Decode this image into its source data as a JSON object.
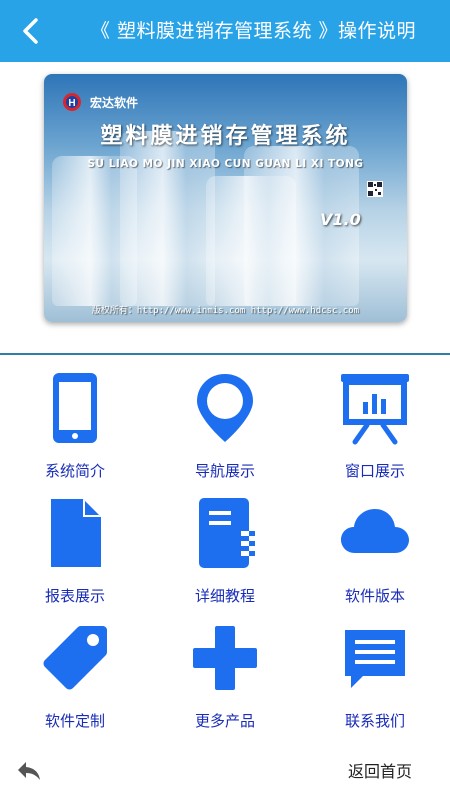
{
  "header": {
    "title": "《 塑料膜进销存管理系统 》操作说明",
    "back_icon": "chevron-left-icon",
    "background": "#29a3e8"
  },
  "banner": {
    "company": "宏达软件",
    "product_title": "塑料膜进销存管理系统",
    "pinyin": "SU LIAO MO JIN XIAO CUN GUAN LI XI TONG",
    "version": "V1.0",
    "copyright": "版权所有：http://www.inmis.com http://www.hdcsc.com"
  },
  "grid": {
    "accent": "#1e6ff0",
    "label_color": "#1a2db8",
    "items": [
      {
        "label": "系统简介",
        "icon": "phone-icon"
      },
      {
        "label": "导航展示",
        "icon": "map-pin-icon"
      },
      {
        "label": "窗口展示",
        "icon": "presentation-icon"
      },
      {
        "label": "报表展示",
        "icon": "document-icon"
      },
      {
        "label": "详细教程",
        "icon": "notebook-icon"
      },
      {
        "label": "软件版本",
        "icon": "cloud-icon"
      },
      {
        "label": "软件定制",
        "icon": "tag-icon"
      },
      {
        "label": "更多产品",
        "icon": "plus-icon"
      },
      {
        "label": "联系我们",
        "icon": "message-icon"
      }
    ]
  },
  "footer": {
    "back_icon": "reply-arrow-icon",
    "home_label": "返回首页"
  }
}
